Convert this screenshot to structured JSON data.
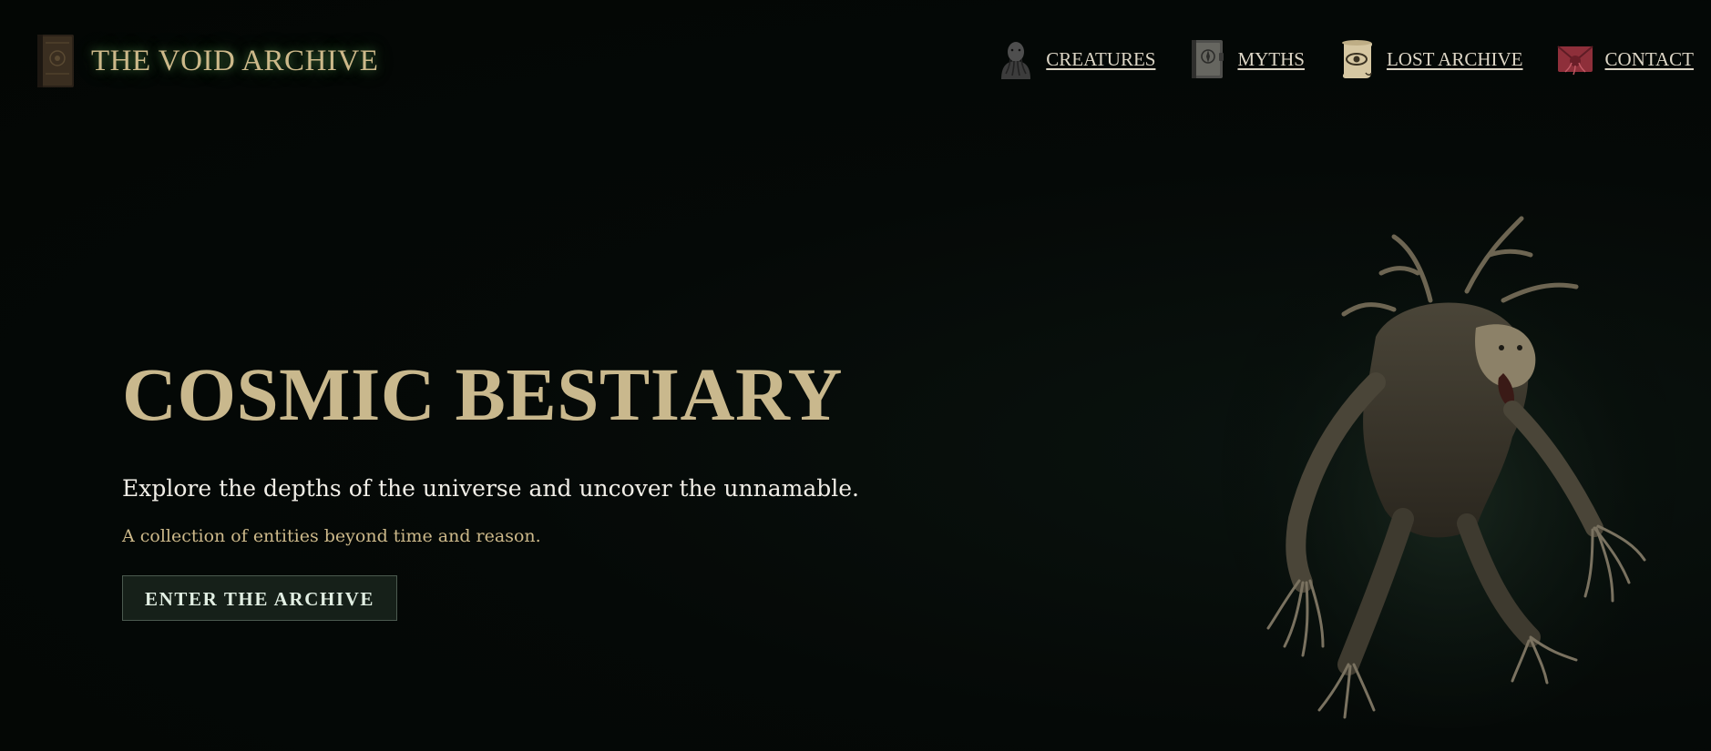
{
  "header": {
    "brand_title": "THE VOID ARCHIVE",
    "logo_icon": "book-icon"
  },
  "nav": {
    "items": [
      {
        "label": "CREATURES",
        "icon": "tentacle-silhouette-icon"
      },
      {
        "label": "MYTHS",
        "icon": "tome-icon"
      },
      {
        "label": "LOST ARCHIVE",
        "icon": "eye-scroll-icon"
      },
      {
        "label": "CONTACT",
        "icon": "seal-envelope-icon"
      }
    ]
  },
  "hero": {
    "title": "COSMIC BESTIARY",
    "tagline": "Explore the depths of the universe and uncover the unnamable.",
    "subtitle": "A collection of entities beyond time and reason.",
    "cta_label": "ENTER THE ARCHIVE"
  },
  "colors": {
    "background": "#040806",
    "accent_gold": "#c9b88d",
    "glow_green": "#78c86e",
    "button_bg": "#162019",
    "nav_text": "#ddd6c6"
  }
}
